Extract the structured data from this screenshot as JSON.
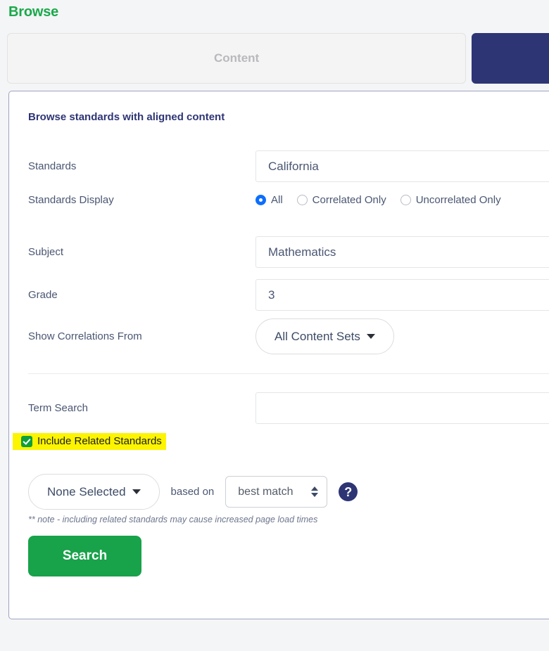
{
  "page": {
    "title": "Browse"
  },
  "tabs": [
    {
      "label": "Content",
      "state": "inactive"
    },
    {
      "label": "",
      "state": "active"
    }
  ],
  "card": {
    "title": "Browse standards with aligned content",
    "rows": {
      "standards": {
        "label": "Standards",
        "value": "California"
      },
      "standards_display": {
        "label": "Standards Display",
        "options": [
          {
            "label": "All",
            "selected": true
          },
          {
            "label": "Correlated Only",
            "selected": false
          },
          {
            "label": "Uncorrelated Only",
            "selected": false
          }
        ]
      },
      "subject": {
        "label": "Subject",
        "value": "Mathematics"
      },
      "grade": {
        "label": "Grade",
        "value": "3"
      },
      "show_correlations_from": {
        "label": "Show Correlations From",
        "value": "All Content Sets"
      },
      "term_search": {
        "label": "Term Search",
        "value": "",
        "placeholder": ""
      }
    },
    "include_related": {
      "label": "Include Related Standards",
      "checked": true,
      "highlight_color": "#fcf400"
    },
    "related_controls": {
      "selection_label": "None Selected",
      "based_on_label": "based on",
      "match_value": "best match",
      "help_icon_glyph": "?"
    },
    "note": "** note - including related standards may cause increased page load times",
    "search_button": "Search"
  },
  "colors": {
    "brand_green": "#1aa94b",
    "brand_navy": "#2e3575",
    "highlight_yellow": "#fcf400",
    "radio_blue": "#0d6efd",
    "checkbox_green": "#0e9f3c"
  }
}
